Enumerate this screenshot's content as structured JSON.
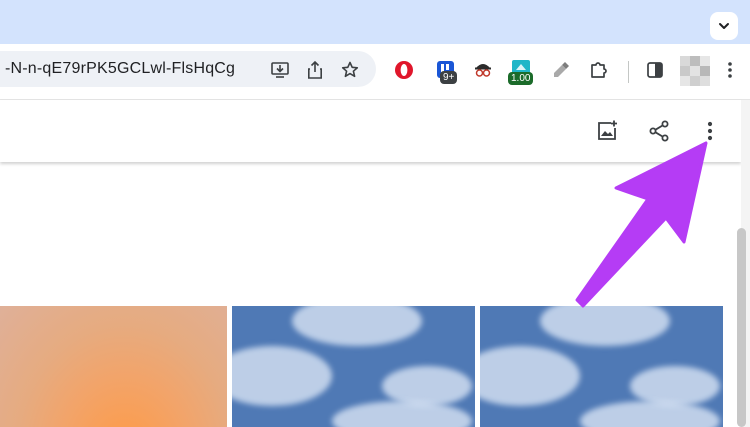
{
  "browser": {
    "url": "-N-n-qE79rPK5GCLwl-FlsHqCg",
    "extensions": [
      {
        "name": "opera-extension-icon",
        "badge": ""
      },
      {
        "name": "tasks-extension-icon",
        "badge": "9+"
      },
      {
        "name": "spy-extension-icon",
        "badge": ""
      },
      {
        "name": "speed-extension-icon",
        "badge": "1.00"
      },
      {
        "name": "color-picker-extension-icon",
        "badge": ""
      }
    ]
  },
  "colors": {
    "tabstrip": "#d3e3fd",
    "annotation_arrow": "#b53cf5",
    "sky_photo": "#4f79b5"
  },
  "page": {
    "appbar_icons": [
      "add-to-album-icon",
      "share-icon",
      "more-options-icon"
    ]
  }
}
